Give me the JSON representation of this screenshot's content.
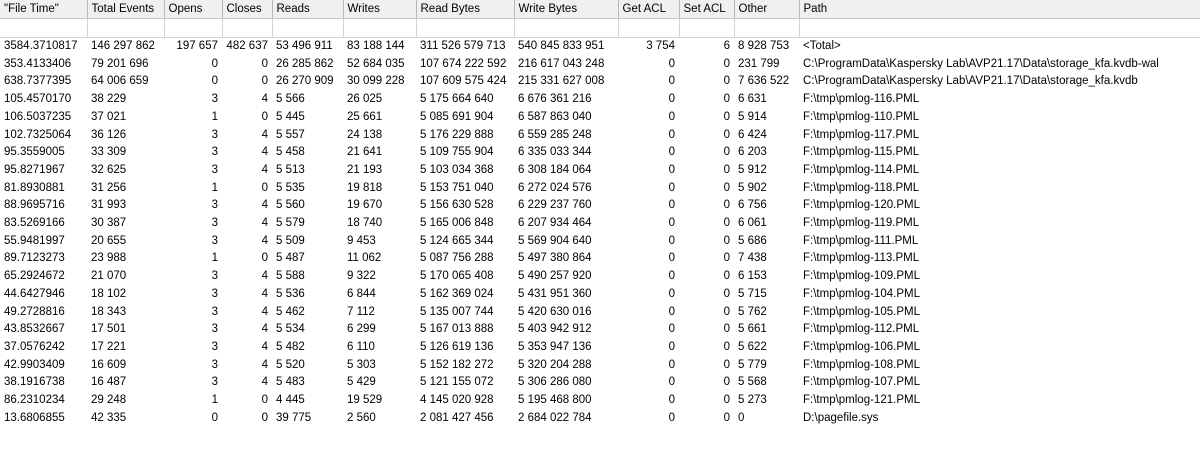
{
  "columns": [
    {
      "key": "file_time",
      "label": "\"File Time\""
    },
    {
      "key": "total_events",
      "label": "Total Events"
    },
    {
      "key": "opens",
      "label": "Opens"
    },
    {
      "key": "closes",
      "label": "Closes"
    },
    {
      "key": "reads",
      "label": "Reads"
    },
    {
      "key": "writes",
      "label": "Writes"
    },
    {
      "key": "read_bytes",
      "label": "Read Bytes"
    },
    {
      "key": "write_bytes",
      "label": "Write Bytes"
    },
    {
      "key": "get_acl",
      "label": "Get ACL"
    },
    {
      "key": "set_acl",
      "label": "Set ACL"
    },
    {
      "key": "other",
      "label": "Other"
    },
    {
      "key": "path",
      "label": "Path"
    }
  ],
  "rows": [
    [
      "3584.3710817",
      "146 297 862",
      "197 657",
      "482 637",
      "53 496 911",
      "83 188 144",
      "311 526 579 713",
      "540 845 833 951",
      "3 754",
      "6",
      "8 928 753",
      "<Total>"
    ],
    [
      "353.4133406",
      "79 201 696",
      "0",
      "0",
      "26 285 862",
      "52 684 035",
      "107 674 222 592",
      "216 617 043 248",
      "0",
      "0",
      "231 799",
      "C:\\ProgramData\\Kaspersky Lab\\AVP21.17\\Data\\storage_kfa.kvdb-wal"
    ],
    [
      "638.7377395",
      "64 006 659",
      "0",
      "0",
      "26 270 909",
      "30 099 228",
      "107 609 575 424",
      "215 331 627 008",
      "0",
      "0",
      "7 636 522",
      "C:\\ProgramData\\Kaspersky Lab\\AVP21.17\\Data\\storage_kfa.kvdb"
    ],
    [
      "105.4570170",
      "38 229",
      "3",
      "4",
      "5 566",
      "26 025",
      "5 175 664 640",
      "6 676 361 216",
      "0",
      "0",
      "6 631",
      "F:\\tmp\\pmlog-116.PML"
    ],
    [
      "106.5037235",
      "37 021",
      "1",
      "0",
      "5 445",
      "25 661",
      "5 085 691 904",
      "6 587 863 040",
      "0",
      "0",
      "5 914",
      "F:\\tmp\\pmlog-110.PML"
    ],
    [
      "102.7325064",
      "36 126",
      "3",
      "4",
      "5 557",
      "24 138",
      "5 176 229 888",
      "6 559 285 248",
      "0",
      "0",
      "6 424",
      "F:\\tmp\\pmlog-117.PML"
    ],
    [
      "95.3559005",
      "33 309",
      "3",
      "4",
      "5 458",
      "21 641",
      "5 109 755 904",
      "6 335 033 344",
      "0",
      "0",
      "6 203",
      "F:\\tmp\\pmlog-115.PML"
    ],
    [
      "95.8271967",
      "32 625",
      "3",
      "4",
      "5 513",
      "21 193",
      "5 103 034 368",
      "6 308 184 064",
      "0",
      "0",
      "5 912",
      "F:\\tmp\\pmlog-114.PML"
    ],
    [
      "81.8930881",
      "31 256",
      "1",
      "0",
      "5 535",
      "19 818",
      "5 153 751 040",
      "6 272 024 576",
      "0",
      "0",
      "5 902",
      "F:\\tmp\\pmlog-118.PML"
    ],
    [
      "88.9695716",
      "31 993",
      "3",
      "4",
      "5 560",
      "19 670",
      "5 156 630 528",
      "6 229 237 760",
      "0",
      "0",
      "6 756",
      "F:\\tmp\\pmlog-120.PML"
    ],
    [
      "83.5269166",
      "30 387",
      "3",
      "4",
      "5 579",
      "18 740",
      "5 165 006 848",
      "6 207 934 464",
      "0",
      "0",
      "6 061",
      "F:\\tmp\\pmlog-119.PML"
    ],
    [
      "55.9481997",
      "20 655",
      "3",
      "4",
      "5 509",
      "9 453",
      "5 124 665 344",
      "5 569 904 640",
      "0",
      "0",
      "5 686",
      "F:\\tmp\\pmlog-111.PML"
    ],
    [
      "89.7123273",
      "23 988",
      "1",
      "0",
      "5 487",
      "11 062",
      "5 087 756 288",
      "5 497 380 864",
      "0",
      "0",
      "7 438",
      "F:\\tmp\\pmlog-113.PML"
    ],
    [
      "65.2924672",
      "21 070",
      "3",
      "4",
      "5 588",
      "9 322",
      "5 170 065 408",
      "5 490 257 920",
      "0",
      "0",
      "6 153",
      "F:\\tmp\\pmlog-109.PML"
    ],
    [
      "44.6427946",
      "18 102",
      "3",
      "4",
      "5 536",
      "6 844",
      "5 162 369 024",
      "5 431 951 360",
      "0",
      "0",
      "5 715",
      "F:\\tmp\\pmlog-104.PML"
    ],
    [
      "49.2728816",
      "18 343",
      "3",
      "4",
      "5 462",
      "7 112",
      "5 135 007 744",
      "5 420 630 016",
      "0",
      "0",
      "5 762",
      "F:\\tmp\\pmlog-105.PML"
    ],
    [
      "43.8532667",
      "17 501",
      "3",
      "4",
      "5 534",
      "6 299",
      "5 167 013 888",
      "5 403 942 912",
      "0",
      "0",
      "5 661",
      "F:\\tmp\\pmlog-112.PML"
    ],
    [
      "37.0576242",
      "17 221",
      "3",
      "4",
      "5 482",
      "6 110",
      "5 126 619 136",
      "5 353 947 136",
      "0",
      "0",
      "5 622",
      "F:\\tmp\\pmlog-106.PML"
    ],
    [
      "42.9903409",
      "16 609",
      "3",
      "4",
      "5 520",
      "5 303",
      "5 152 182 272",
      "5 320 204 288",
      "0",
      "0",
      "5 779",
      "F:\\tmp\\pmlog-108.PML"
    ],
    [
      "38.1916738",
      "16 487",
      "3",
      "4",
      "5 483",
      "5 429",
      "5 121 155 072",
      "5 306 286 080",
      "0",
      "0",
      "5 568",
      "F:\\tmp\\pmlog-107.PML"
    ],
    [
      "86.2310234",
      "29 248",
      "1",
      "0",
      "4 445",
      "19 529",
      "4 145 020 928",
      "5 195 468 800",
      "0",
      "0",
      "5 273",
      "F:\\tmp\\pmlog-121.PML"
    ],
    [
      "13.6806855",
      "42 335",
      "0",
      "0",
      "39 775",
      "2 560",
      "2 081 427 456",
      "2 684 022 784",
      "0",
      "0",
      "0",
      "D:\\pagefile.sys"
    ]
  ]
}
